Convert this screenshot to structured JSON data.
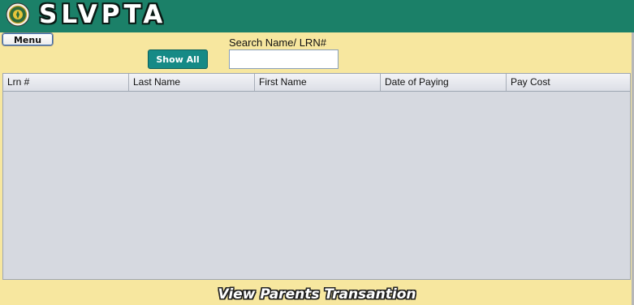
{
  "header": {
    "title": "SLVPTA",
    "logo_icon": "seal-logo-icon",
    "bg_color": "#1b8068"
  },
  "toolbar": {
    "menu_label": "Menu",
    "show_all_label": "Show All",
    "search_label": "Search Name/ LRN#",
    "search_value": "",
    "accent_color": "#168a86"
  },
  "table": {
    "columns": [
      "Lrn #",
      "Last Name",
      "First Name",
      "Date of Paying",
      "Pay Cost"
    ],
    "rows": []
  },
  "footer": {
    "title": "View Parents Transantion"
  }
}
